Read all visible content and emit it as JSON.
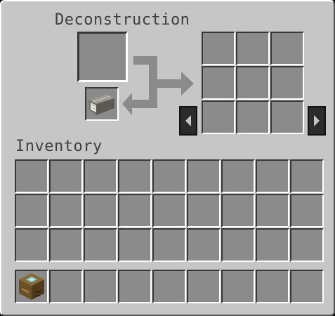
{
  "window": {
    "title": "Deconstruction",
    "inventory_label": "Inventory"
  },
  "deconstruction": {
    "input_slot": {
      "item": ""
    },
    "book_slot": {
      "item": "book-icon"
    },
    "output_grid_rows": 3,
    "output_grid_cols": 3,
    "prev_button_icon": "left-arrow-icon",
    "next_button_icon": "right-arrow-icon"
  },
  "inventory": {
    "main_rows": 3,
    "cols": 9,
    "hotbar": [
      {
        "item": "machine-block-icon"
      }
    ]
  },
  "colors": {
    "panel_bg": "#c6c6c6",
    "slot_bg": "#8b8b8b",
    "label_text": "#404040",
    "arrow_flow": "#8b8b8b",
    "button_bg": "#2b2b2b"
  }
}
